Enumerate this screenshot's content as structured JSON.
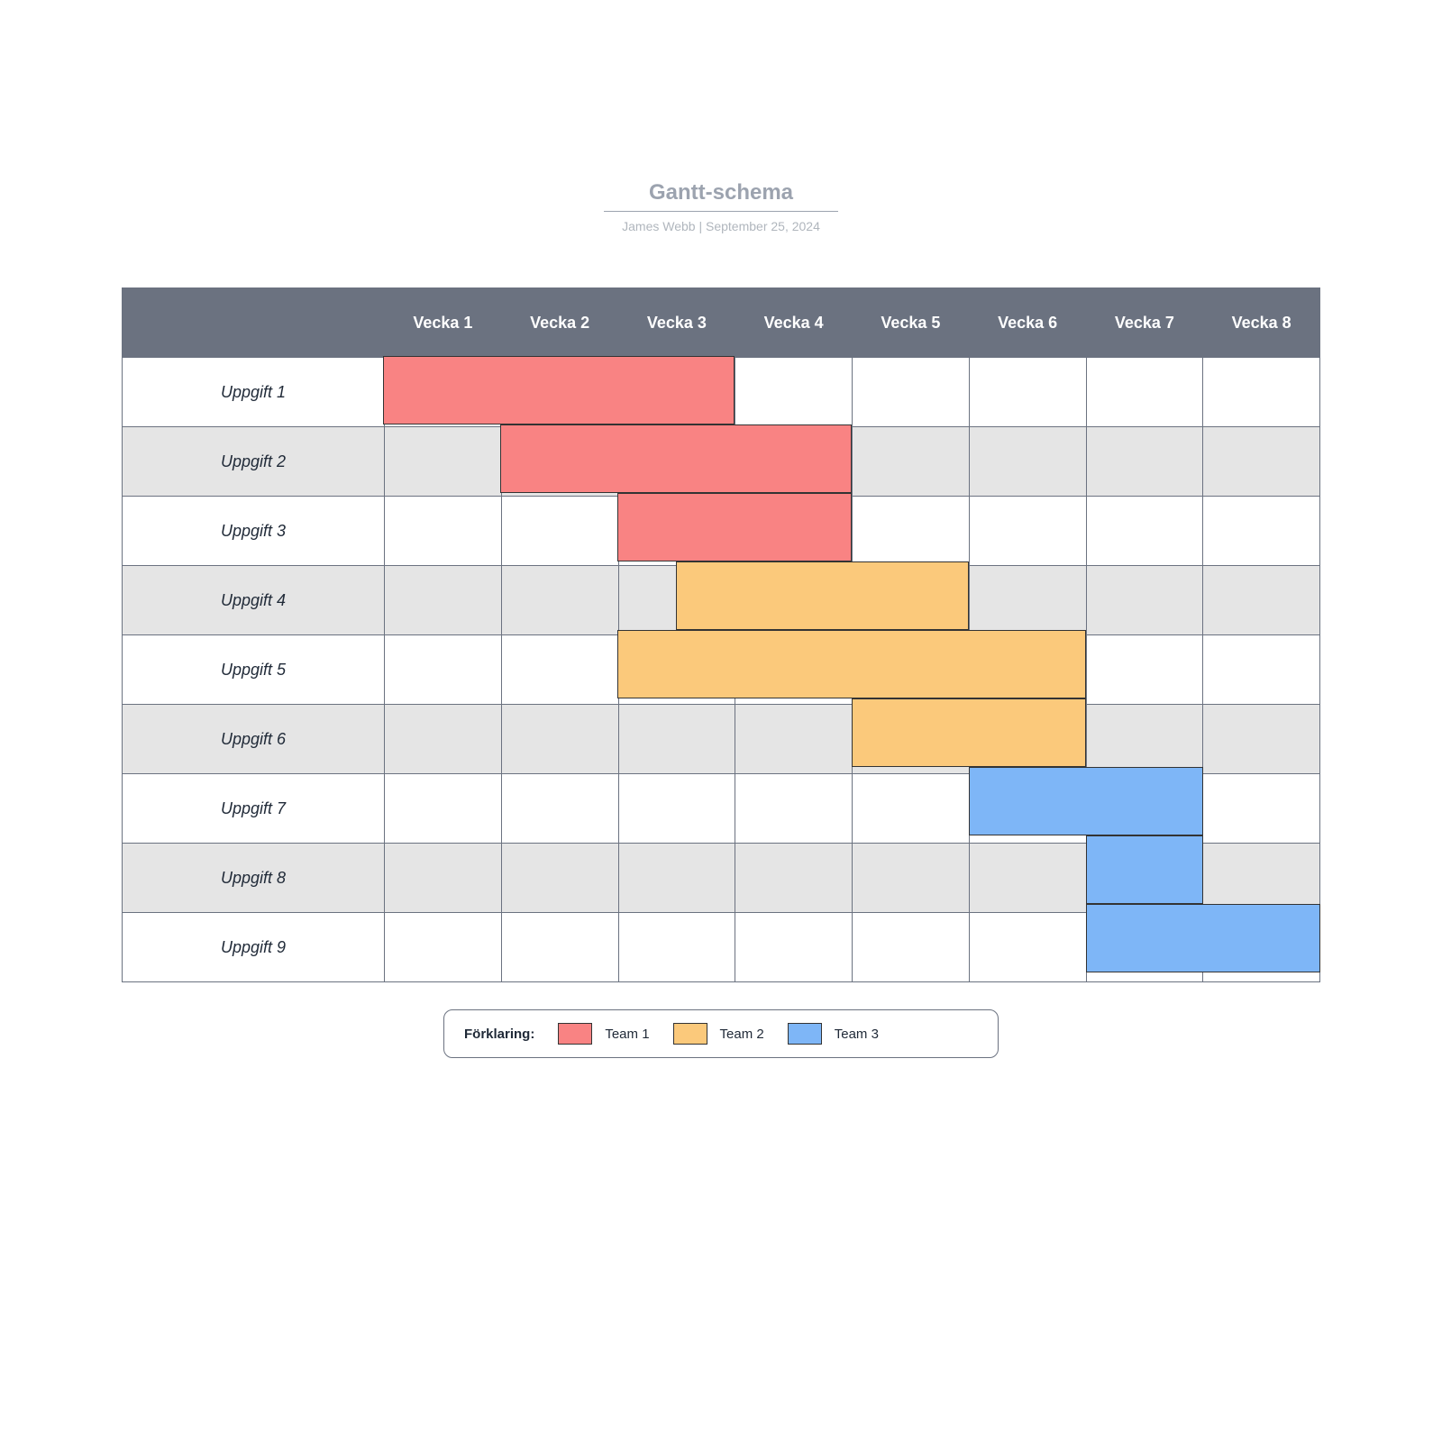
{
  "title": "Gantt-schema",
  "author": "James Webb",
  "sep": "  |  ",
  "date": "September 25, 2024",
  "legend_label": "Förklaring:",
  "teams": [
    {
      "name": "Team 1",
      "color": "#f98383"
    },
    {
      "name": "Team 2",
      "color": "#fbc97b"
    },
    {
      "name": "Team 3",
      "color": "#7eb6f7"
    }
  ],
  "chart_data": {
    "type": "gantt",
    "columns": [
      "Vecka 1",
      "Vecka 2",
      "Vecka 3",
      "Vecka 4",
      "Vecka 5",
      "Vecka 6",
      "Vecka 7",
      "Vecka 8"
    ],
    "tasks": [
      {
        "name": "Uppgift 1",
        "team": 0,
        "start": 1.0,
        "end": 4.0
      },
      {
        "name": "Uppgift 2",
        "team": 0,
        "start": 2.0,
        "end": 5.0
      },
      {
        "name": "Uppgift 3",
        "team": 0,
        "start": 3.0,
        "end": 5.0
      },
      {
        "name": "Uppgift 4",
        "team": 1,
        "start": 3.5,
        "end": 6.0
      },
      {
        "name": "Uppgift 5",
        "team": 1,
        "start": 3.0,
        "end": 7.0
      },
      {
        "name": "Uppgift 6",
        "team": 1,
        "start": 5.0,
        "end": 7.0
      },
      {
        "name": "Uppgift 7",
        "team": 2,
        "start": 6.0,
        "end": 8.0
      },
      {
        "name": "Uppgift 8",
        "team": 2,
        "start": 7.0,
        "end": 8.0
      },
      {
        "name": "Uppgift 9",
        "team": 2,
        "start": 7.0,
        "end": 9.0
      }
    ]
  }
}
